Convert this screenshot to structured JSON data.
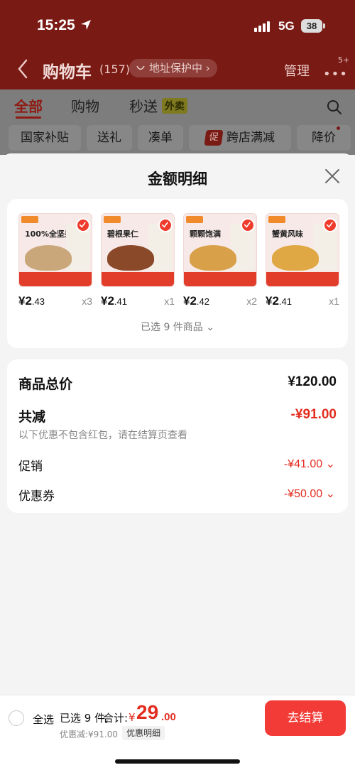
{
  "status_bar": {
    "time": "15:25",
    "network": "5G",
    "battery": "38"
  },
  "cart_header": {
    "title": "购物车",
    "count": "(157)",
    "address_protect": "地址保护中",
    "manage": "管理",
    "more_badge": "5+"
  },
  "tabs": [
    {
      "label": "全部",
      "active": true
    },
    {
      "label": "购物"
    },
    {
      "label": "秒送",
      "tag": "外卖"
    }
  ],
  "filter_chips": [
    "国家补贴",
    "送礼",
    "凑单",
    "跨店满减",
    "降价"
  ],
  "promo_tag": "促",
  "sheet": {
    "title": "金额明细",
    "products": [
      {
        "name": "100%全坚果",
        "price_int": "¥2",
        "price_dec": ".43",
        "qty": "x3",
        "pile_color": "#c9a77a"
      },
      {
        "name": "碧根果仁",
        "price_int": "¥2",
        "price_dec": ".41",
        "qty": "x1",
        "pile_color": "#8a4a2a"
      },
      {
        "name": "颗颗饱满",
        "price_int": "¥2",
        "price_dec": ".42",
        "qty": "x2",
        "pile_color": "#d9a04a"
      },
      {
        "name": "蟹黄风味",
        "price_int": "¥2",
        "price_dec": ".41",
        "qty": "x1",
        "pile_color": "#e0a844"
      }
    ],
    "selected_summary": "已选 9 件商品 ⌄",
    "summary": {
      "total_label": "商品总价",
      "total_value": "¥120.00",
      "reduce_label": "共减",
      "reduce_value": "-¥91.00",
      "reduce_note": "以下优惠不包含红包，请在结算页查看",
      "promo_label": "促销",
      "promo_value": "-¥41.00 ⌄",
      "coupon_label": "优惠券",
      "coupon_value": "-¥50.00 ⌄"
    }
  },
  "bottom_bar": {
    "select_all": "全选",
    "selected_count": "已选 9 件,",
    "total_label": "合计:",
    "currency": "¥",
    "total_int": "29",
    "total_dec": ".00",
    "discount_note": "优惠减:¥91.00",
    "detail_button": "优惠明细",
    "checkout_button": "去结算"
  },
  "colors": {
    "accent_red": "#e22d1f",
    "checkout_red": "#f23b36"
  }
}
